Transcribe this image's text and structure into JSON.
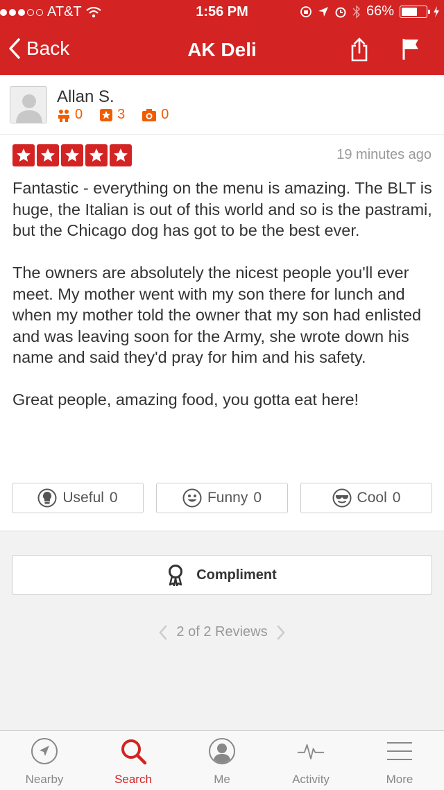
{
  "status_bar": {
    "carrier": "AT&T",
    "time": "1:56 PM",
    "battery": "66%",
    "battery_level": 0.66
  },
  "nav": {
    "back_label": "Back",
    "title": "AK Deli"
  },
  "review": {
    "author": "Allan S.",
    "friends_count": "0",
    "reviews_count": "3",
    "photos_count": "0",
    "rating": 5,
    "time_ago": "19 minutes ago",
    "paragraphs": [
      "Fantastic - everything on the menu is amazing. The BLT is huge, the Italian is out of this world and so is the pastrami, but the Chicago dog has got to be the best ever.",
      "The owners are absolutely the nicest people you'll ever meet. My mother went with my son there for lunch and when my mother told the owner that my son had enlisted and was leaving soon for the Army, she wrote down his name and said they'd pray for him and his safety.",
      "Great people, amazing food, you gotta eat here!"
    ],
    "votes": {
      "useful": {
        "label": "Useful",
        "count": "0"
      },
      "funny": {
        "label": "Funny",
        "count": "0"
      },
      "cool": {
        "label": "Cool",
        "count": "0"
      }
    }
  },
  "compliment_label": "Compliment",
  "pager": {
    "label": "2 of 2 Reviews"
  },
  "tabs": [
    {
      "label": "Nearby",
      "icon": "nearby-icon"
    },
    {
      "label": "Search",
      "icon": "search-icon"
    },
    {
      "label": "Me",
      "icon": "me-icon"
    },
    {
      "label": "Activity",
      "icon": "activity-icon"
    },
    {
      "label": "More",
      "icon": "more-icon"
    }
  ],
  "colors": {
    "brand_red": "#d32323",
    "stat_orange": "#f15c00",
    "muted_gray": "#999999"
  }
}
